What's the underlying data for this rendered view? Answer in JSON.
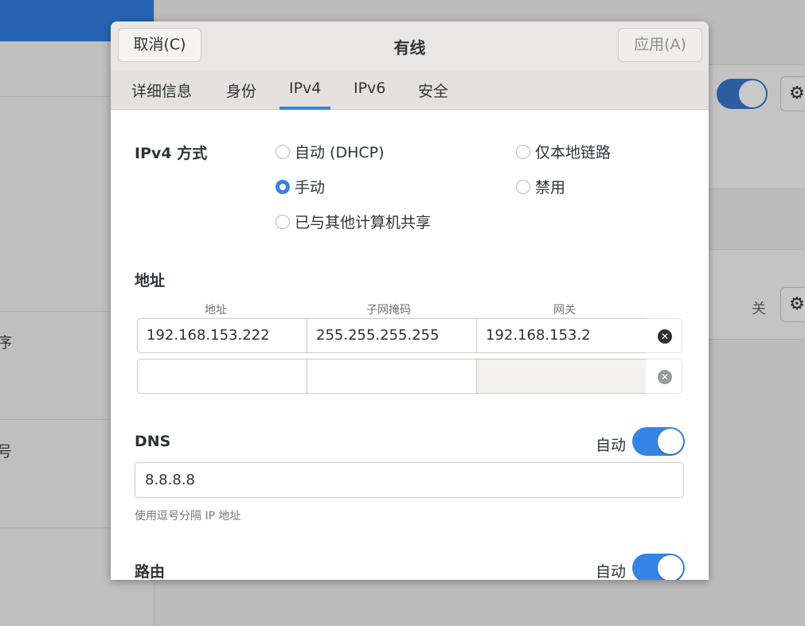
{
  "background": {
    "sidebar_fragments": [
      "序",
      "号"
    ],
    "off_label": "关",
    "gear_icon": "gear-icon"
  },
  "dialog": {
    "title": "有线",
    "cancel_label": "取消(C)",
    "apply_label": "应用(A)",
    "tabs": [
      {
        "label": "详细信息",
        "active": false
      },
      {
        "label": "身份",
        "active": false
      },
      {
        "label": "IPv4",
        "active": true
      },
      {
        "label": "IPv6",
        "active": false
      },
      {
        "label": "安全",
        "active": false
      }
    ],
    "method": {
      "label": "IPv4 方式",
      "options": [
        {
          "label": "自动 (DHCP)",
          "checked": false
        },
        {
          "label": "仅本地链路",
          "checked": false
        },
        {
          "label": "手动",
          "checked": true
        },
        {
          "label": "禁用",
          "checked": false
        },
        {
          "label": "已与其他计算机共享",
          "checked": false
        }
      ]
    },
    "addresses": {
      "label": "地址",
      "columns": [
        "地址",
        "子网掩码",
        "网关"
      ],
      "rows": [
        {
          "address": "192.168.153.222",
          "netmask": "255.255.255.255",
          "gateway": "192.168.153.2"
        },
        {
          "address": "",
          "netmask": "",
          "gateway": ""
        }
      ]
    },
    "dns": {
      "label": "DNS",
      "auto_label": "自动",
      "auto_on": true,
      "value": "8.8.8.8",
      "hint": "使用逗号分隔 IP 地址"
    },
    "routes": {
      "label": "路由",
      "auto_label": "自动",
      "auto_on": true
    },
    "colors": {
      "accent": "#3584e4",
      "header_bg": "#e9e7e4"
    }
  }
}
